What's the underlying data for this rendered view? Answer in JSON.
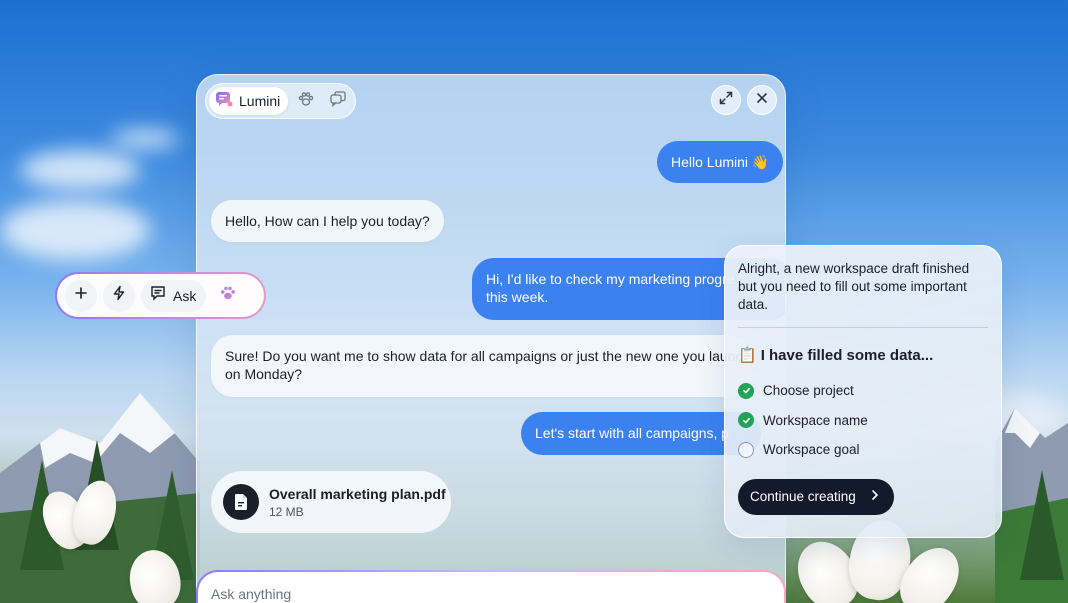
{
  "assistant": {
    "name": "Lumini"
  },
  "messages": {
    "user_greeting": "Hello Lumini 👋",
    "bot_greeting": "Hello, How can I help you today?",
    "user_request_line1": "Hi, I'd like to check my marketing progre",
    "user_request_line2": "this week.",
    "bot_question_line1": "Sure! Do you want me to show data for all campaigns or just the new one you launc",
    "bot_question_line2": "on Monday?",
    "user_answer": "Let's start with all campaigns, p"
  },
  "attachment": {
    "name": "Overall marketing plan.pdf",
    "size": "12 MB"
  },
  "input": {
    "placeholder": "Ask anything"
  },
  "toolbar": {
    "ask_label": "Ask"
  },
  "workspace_card": {
    "message_line1": "Alright, a new workspace draft finished",
    "message_line2": "but you need to fill out some important",
    "message_line3": "data.",
    "heading_emoji": "📋",
    "heading": "I have filled some data...",
    "items": [
      {
        "label": "Choose project",
        "done": true
      },
      {
        "label": "Workspace name",
        "done": true
      },
      {
        "label": "Workspace goal",
        "done": false
      }
    ],
    "cta_label": "Continue creating"
  },
  "colors": {
    "user_bubble": "#3b82f0",
    "cta": "#131a2b",
    "check_done": "#22a355"
  },
  "icons": [
    "lumini-logo-icon",
    "paw-icon",
    "chats-icon",
    "expand-icon",
    "close-icon",
    "plus-icon",
    "lightning-icon",
    "ask-icon",
    "paw-color-icon",
    "document-icon",
    "check-icon",
    "chevron-right-icon"
  ]
}
